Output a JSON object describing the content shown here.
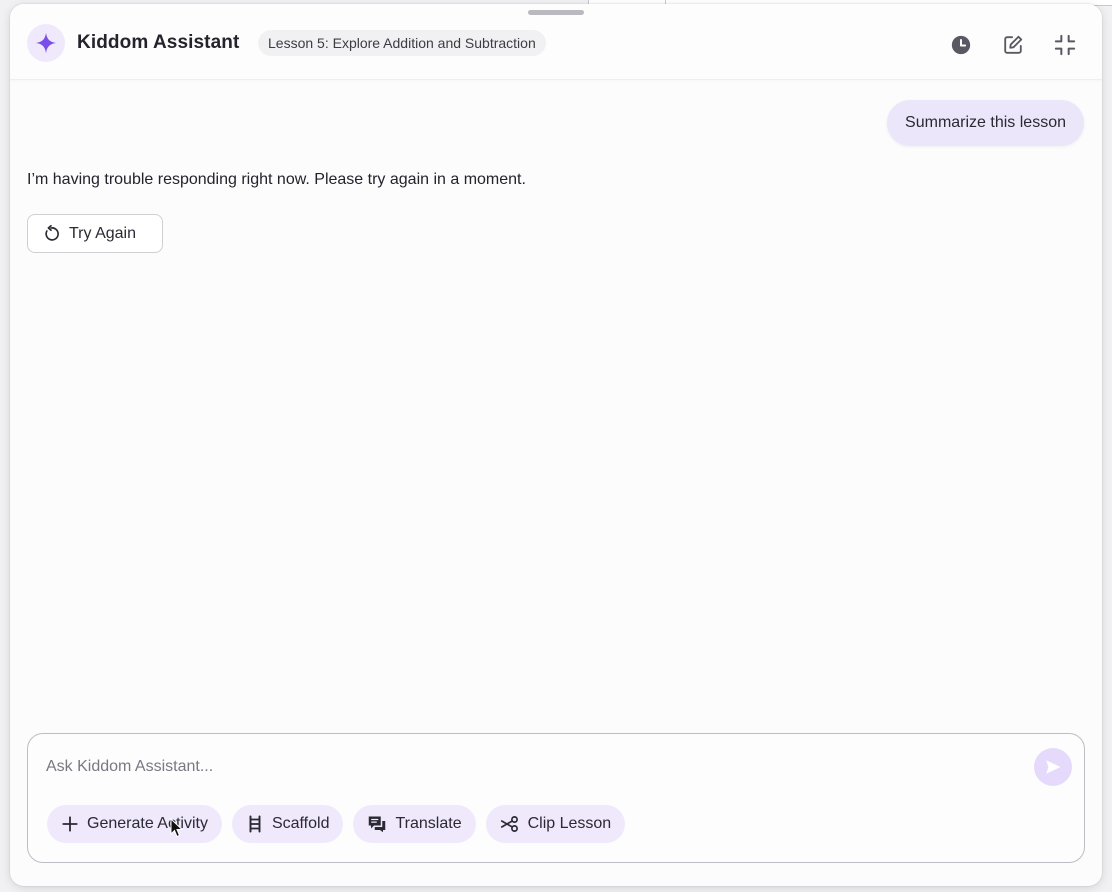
{
  "header": {
    "title": "Kiddom Assistant",
    "lesson_chip": "Lesson 5: Explore Addition and Subtraction",
    "icons": [
      "sparkle-icon",
      "history-icon",
      "new-chat-icon",
      "minimize-icon"
    ]
  },
  "conversation": {
    "user_message": "Summarize this lesson",
    "assistant_message": "I’m having trouble responding right now. Please try again in a moment.",
    "try_again_label": "Try Again"
  },
  "composer": {
    "placeholder": "Ask Kiddom Assistant...",
    "value": "",
    "actions": [
      {
        "label": "Generate Activity",
        "icon": "plus-icon"
      },
      {
        "label": "Scaffold",
        "icon": "ladder-icon"
      },
      {
        "label": "Translate",
        "icon": "translate-icon"
      },
      {
        "label": "Clip Lesson",
        "icon": "scissors-icon"
      }
    ]
  },
  "colors": {
    "accent": "#7a4ee8",
    "chip_bg": "#efe9fb",
    "user_bubble_bg": "#ece6fa",
    "send_button_bg": "#e5dafc"
  }
}
